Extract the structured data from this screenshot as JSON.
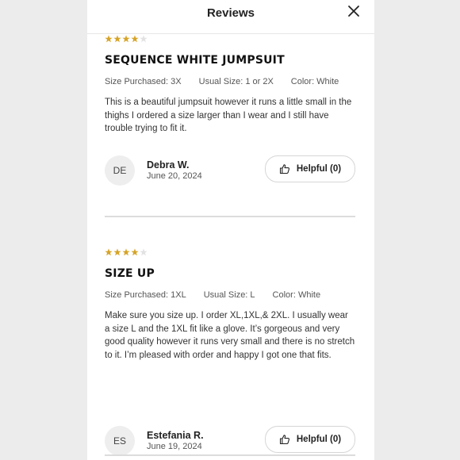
{
  "header": {
    "title": "Reviews"
  },
  "reviews": [
    {
      "rating": 4,
      "max_rating": 5,
      "title": "SEQUENCE WHITE JUMPSUIT",
      "size_purchased": "Size Purchased: 3X",
      "usual_size": "Usual Size: 1 or 2X",
      "color": "Color: White",
      "body": "This is a beautiful jumpsuit however it runs a little small in the thighs I ordered a size larger than I wear and I still have trouble trying to fit it.",
      "initials": "DE",
      "author": "Debra W.",
      "date": "June 20, 2024",
      "helpful_label": "Helpful (0)"
    },
    {
      "rating": 4,
      "max_rating": 5,
      "title": "SIZE UP",
      "size_purchased": "Size Purchased: 1XL",
      "usual_size": "Usual Size: L",
      "color": "Color: White",
      "body": "Make sure you size up. I order XL,1XL,& 2XL. I usually wear a size L and the 1XL fit like a glove. It’s gorgeous and very good quality however it runs very small and there is no stretch to it. I’m pleased with order and happy I got one that fits.",
      "initials": "ES",
      "author": "Estefania R.",
      "date": "June 19, 2024",
      "helpful_label": "Helpful (0)"
    }
  ],
  "colors": {
    "star_filled": "#d6a429",
    "star_empty": "#e2e2e2"
  },
  "icons": {
    "close": "close-icon",
    "thumbs_up": "thumbs-up-icon",
    "star": "star-icon"
  }
}
